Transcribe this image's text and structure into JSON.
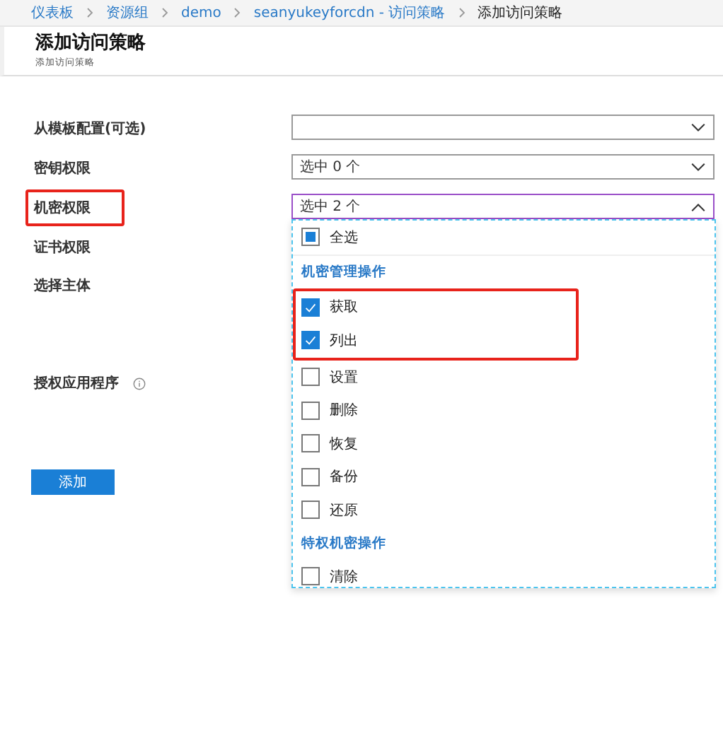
{
  "breadcrumb": [
    {
      "label": "仪表板",
      "current": false
    },
    {
      "label": "资源组",
      "current": false
    },
    {
      "label": "demo",
      "current": false
    },
    {
      "label": "seanyukeyforcdn - 访问策略",
      "current": false
    },
    {
      "label": "添加访问策略",
      "current": true
    }
  ],
  "header": {
    "title": "添加访问策略",
    "subtitle": "添加访问策略"
  },
  "fields": [
    {
      "label": "从模板配置(可选)",
      "kind": "select",
      "open": false,
      "highlighted": false
    },
    {
      "label": "密钥权限",
      "kind": "select",
      "value": "选中 0 个",
      "open": false,
      "highlighted": false
    },
    {
      "label": "机密权限",
      "kind": "select",
      "value": "选中 2 个",
      "open": true,
      "highlighted": true
    },
    {
      "label": "证书权限",
      "kind": "plain",
      "highlighted": false
    },
    {
      "label": "选择主体",
      "kind": "tall",
      "highlighted": false
    },
    {
      "label": "授权应用程序",
      "kind": "info",
      "highlighted": false
    }
  ],
  "dropdown": {
    "select_all": {
      "label": "全选",
      "indeterminate": true
    },
    "groups": [
      {
        "heading": "机密管理操作",
        "items": [
          {
            "label": "获取",
            "checked": true,
            "highlighted": true
          },
          {
            "label": "列出",
            "checked": true,
            "highlighted": true
          },
          {
            "label": "设置",
            "checked": false,
            "highlighted": false
          },
          {
            "label": "删除",
            "checked": false,
            "highlighted": false
          },
          {
            "label": "恢复",
            "checked": false,
            "highlighted": false
          },
          {
            "label": "备份",
            "checked": false,
            "highlighted": false
          },
          {
            "label": "还原",
            "checked": false,
            "highlighted": false
          }
        ]
      },
      {
        "heading": "特权机密操作",
        "items": [
          {
            "label": "清除",
            "checked": false,
            "highlighted": false
          }
        ]
      }
    ]
  },
  "submit": "添加"
}
